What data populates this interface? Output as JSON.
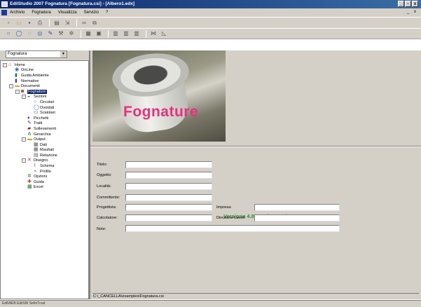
{
  "window": {
    "title": "EdilStudio 2007 Fognatura [Fognatura.csi] - [Albero1.edx]",
    "controls": [
      "_",
      "▫",
      "x"
    ]
  },
  "menu": {
    "items": [
      "Archivio",
      "Fognatura",
      "Visualizza",
      "Servizio",
      "?"
    ],
    "mdi_controls": [
      "_",
      "x"
    ]
  },
  "toolbar1": [
    "new-icon",
    "open-icon",
    "save-icon",
    "print-icon",
    "preview-icon",
    "export-icon",
    "link-icon",
    "copy-icon"
  ],
  "toolbar2": [
    "circle-icon",
    "circle2-icon",
    "circle3-icon",
    "circle4-icon",
    "pencil-icon",
    "tools-icon",
    "gear-icon",
    "calc-icon",
    "doc-icon",
    "grid-icon",
    "grid2-icon",
    "grid3-icon",
    "compare-icon",
    "chart-icon"
  ],
  "sidebar": {
    "combo_value": "Fognatura",
    "tree": [
      {
        "label": "Home",
        "level": 0,
        "toggle": "-",
        "icon": "home-icon",
        "color": "#c8302a"
      },
      {
        "label": "OnLine",
        "level": 1,
        "toggle": "",
        "icon": "globe-icon",
        "color": "#1f5fb4"
      },
      {
        "label": "Guida Ambiente",
        "level": 1,
        "toggle": "",
        "icon": "book-icon",
        "color": "#2a7a2a"
      },
      {
        "label": "Normative",
        "level": 1,
        "toggle": "",
        "icon": "book-icon",
        "color": "#6a3a9a"
      },
      {
        "label": "Documenti",
        "level": 1,
        "toggle": "-",
        "icon": "folder-icon",
        "color": "#d9a22a"
      },
      {
        "label": "Fognature",
        "level": 2,
        "toggle": "-",
        "icon": "sewer-icon",
        "color": "#c8302a",
        "selected": true
      },
      {
        "label": "Sezioni",
        "level": 3,
        "toggle": "-",
        "icon": "section-icon",
        "color": "#1f5fb4"
      },
      {
        "label": "Circolari",
        "level": 4,
        "toggle": "",
        "icon": "circle-icon",
        "color": "#1f5fb4"
      },
      {
        "label": "Ovoidali",
        "level": 4,
        "toggle": "",
        "icon": "oval-icon",
        "color": "#1f5fb4"
      },
      {
        "label": "Scatolari",
        "level": 4,
        "toggle": "",
        "icon": "box-icon",
        "color": "#1f5fb4"
      },
      {
        "label": "Picchetti",
        "level": 3,
        "toggle": "",
        "icon": "stake-icon",
        "color": "#6a3a9a"
      },
      {
        "label": "Tratti",
        "level": 3,
        "toggle": "",
        "icon": "pencil-icon",
        "color": "#3a3a9a"
      },
      {
        "label": "Sollevamenti",
        "level": 3,
        "toggle": "",
        "icon": "pump-icon",
        "color": "#7a3a3a"
      },
      {
        "label": "Gerarchia",
        "level": 3,
        "toggle": "",
        "icon": "hierarchy-icon",
        "color": "#2a7a2a"
      },
      {
        "label": "Output",
        "level": 3,
        "toggle": "-",
        "icon": "folder-icon",
        "color": "#d9a22a"
      },
      {
        "label": "Dati",
        "level": 4,
        "toggle": "",
        "icon": "table-icon",
        "color": "#555555"
      },
      {
        "label": "Risultati",
        "level": 4,
        "toggle": "",
        "icon": "table-icon",
        "color": "#555555"
      },
      {
        "label": "Relazione",
        "level": 4,
        "toggle": "",
        "icon": "report-icon",
        "color": "#555555"
      },
      {
        "label": "Disegno",
        "level": 3,
        "toggle": "-",
        "icon": "drawing-icon",
        "color": "#c8302a"
      },
      {
        "label": "Schema",
        "level": 4,
        "toggle": "",
        "icon": "schema-icon",
        "color": "#555555"
      },
      {
        "label": "Profilo",
        "level": 4,
        "toggle": "",
        "icon": "profile-icon",
        "color": "#555555"
      },
      {
        "label": "Opzioni",
        "level": 3,
        "toggle": "",
        "icon": "options-icon",
        "color": "#2a7a2a"
      },
      {
        "label": "Guida",
        "level": 3,
        "toggle": "",
        "icon": "help-icon",
        "color": "#c8302a"
      },
      {
        "label": "Excel",
        "level": 3,
        "toggle": "",
        "icon": "excel-icon",
        "color": "#2a7a2a"
      }
    ]
  },
  "banner": {
    "title": "Fognature"
  },
  "form": {
    "version": "Versione 4.80.1 advanced",
    "fields": {
      "titolo": {
        "label": "Titolo:",
        "value": ""
      },
      "oggetto": {
        "label": "Oggetto:",
        "value": ""
      },
      "localita": {
        "label": "Località:",
        "value": ""
      },
      "committente": {
        "label": "Committente:",
        "value": ""
      },
      "progettista": {
        "label": "Progettista:",
        "value": ""
      },
      "calcolatore": {
        "label": "Calcolatore:",
        "value": ""
      },
      "impresa": {
        "label": "Impresa:",
        "value": ""
      },
      "direzione": {
        "label": "Direzione Lavori:",
        "value": ""
      },
      "note": {
        "label": "Note:",
        "value": ""
      }
    }
  },
  "path": "C:\\_CANCELLA\\examples\\Fognatura.csi",
  "statusbar": "EdilWEB    EdilSW    SefinTrust"
}
